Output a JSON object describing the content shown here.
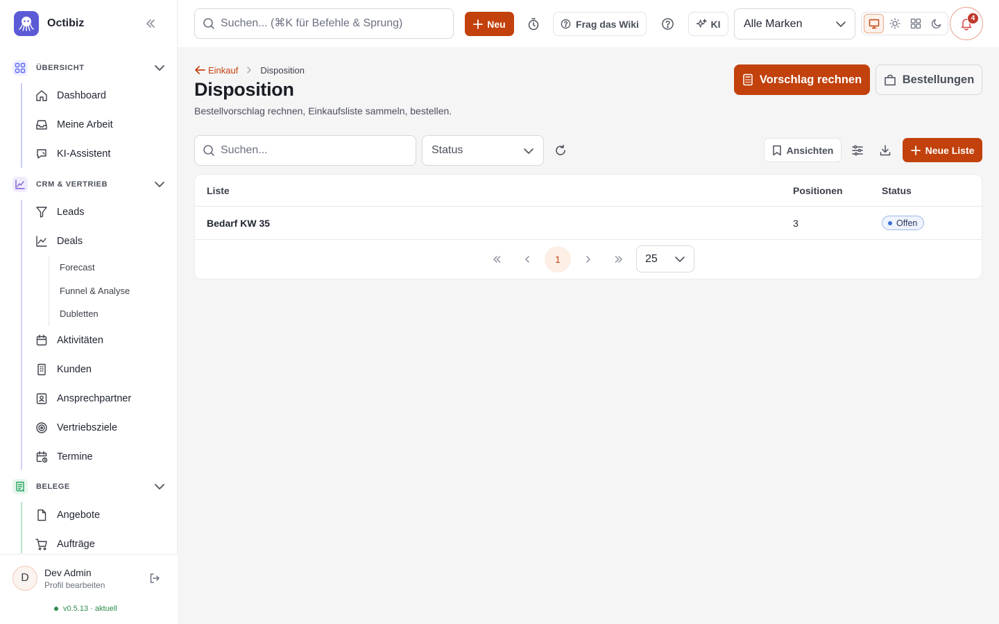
{
  "app": {
    "name": "Octibiz"
  },
  "sidebar": {
    "sections": [
      {
        "label": "ÜBERSICHT",
        "items": [
          "Dashboard",
          "Meine Arbeit",
          "KI-Assistent"
        ]
      },
      {
        "label": "CRM & VERTRIEB",
        "items": [
          "Leads",
          "Deals",
          "Aktivitäten",
          "Kunden",
          "Ansprechpartner",
          "Vertriebsziele",
          "Termine"
        ],
        "subitems": [
          "Forecast",
          "Funnel & Analyse",
          "Dubletten"
        ]
      },
      {
        "label": "BELEGE",
        "items": [
          "Angebote",
          "Aufträge"
        ]
      }
    ],
    "colors": {
      "overview": "#6366f1",
      "crm": "#7c5cd6",
      "belege": "#22a35a"
    }
  },
  "user": {
    "initial": "D",
    "name": "Dev Admin",
    "subtitle": "Profil bearbeiten",
    "version": "v0.5.13",
    "version_status": "· aktuell"
  },
  "topbar": {
    "search_placeholder": "Suchen... (⌘K für Befehle & Sprung)",
    "new_label": "Neu",
    "wiki_label": "Frag das Wiki",
    "ki_label": "KI",
    "brand_select": "Alle Marken",
    "notification_count": "4"
  },
  "page": {
    "breadcrumb_back": "Einkauf",
    "breadcrumb_current": "Disposition",
    "title": "Disposition",
    "subtitle": "Bestellvorschlag rechnen, Einkaufsliste sammeln, bestellen.",
    "primary_action": "Vorschlag rechnen",
    "secondary_action": "Bestellungen"
  },
  "filters": {
    "search_placeholder": "Suchen...",
    "status_placeholder": "Status",
    "views_label": "Ansichten",
    "new_list_label": "Neue Liste"
  },
  "table": {
    "columns": [
      "Liste",
      "Positionen",
      "Status"
    ],
    "rows": [
      {
        "name": "Bedarf KW 35",
        "positions": "3",
        "status": "Offen"
      }
    ]
  },
  "pagination": {
    "current_page": "1",
    "page_size": "25"
  },
  "accent_color": "#c2410c"
}
